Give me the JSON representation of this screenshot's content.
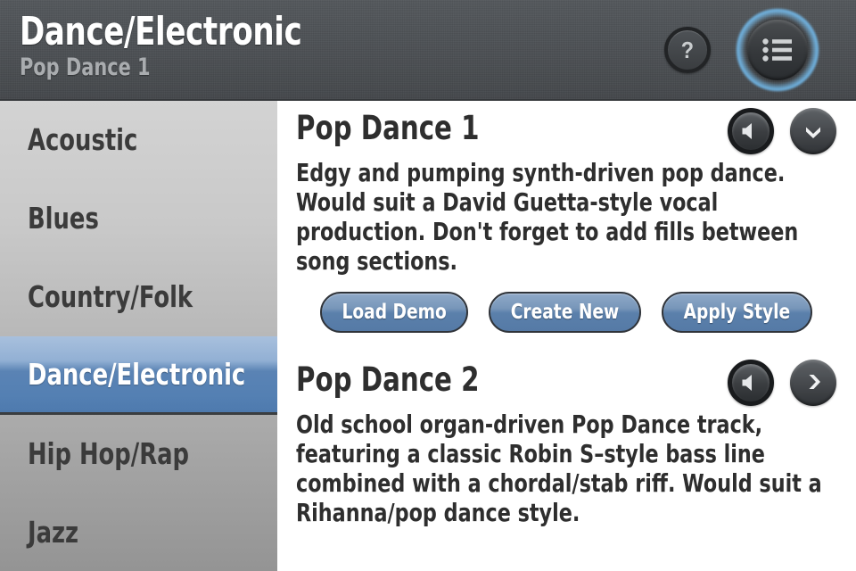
{
  "header": {
    "title": "Dance/Electronic",
    "subtitle": "Pop Dance 1",
    "help_label": "?",
    "help_icon": "question-mark-icon",
    "menu_icon": "list-menu-icon",
    "background_color": "#4b4f53",
    "glow_color": "#5aafff"
  },
  "sidebar": {
    "selected_index": 3,
    "items": [
      {
        "label": "Acoustic"
      },
      {
        "label": "Blues"
      },
      {
        "label": "Country/Folk"
      },
      {
        "label": "Dance/Electronic"
      },
      {
        "label": "Hip Hop/Rap"
      },
      {
        "label": "Jazz"
      }
    ],
    "selected_color": "#5480b3"
  },
  "content": {
    "styles": [
      {
        "title": "Pop Dance 1",
        "description": "Edgy and pumping synth-driven pop dance. Would suit a David Guetta-style vocal production. Don't forget to add fills between song sections.",
        "speaker_icon": "speaker-icon",
        "expand_icon": "chevron-down-icon",
        "actions": [
          {
            "label": "Load Demo"
          },
          {
            "label": "Create New"
          },
          {
            "label": "Apply Style"
          }
        ]
      },
      {
        "title": "Pop Dance 2",
        "description": "Old school organ-driven Pop Dance track, featuring a classic Robin S–style bass line combined with a chordal/stab riff. Would suit a Rihanna/pop dance style.",
        "speaker_icon": "speaker-icon",
        "expand_icon": "chevron-right-icon",
        "actions": []
      }
    ],
    "button_color": "#5b80ab"
  }
}
